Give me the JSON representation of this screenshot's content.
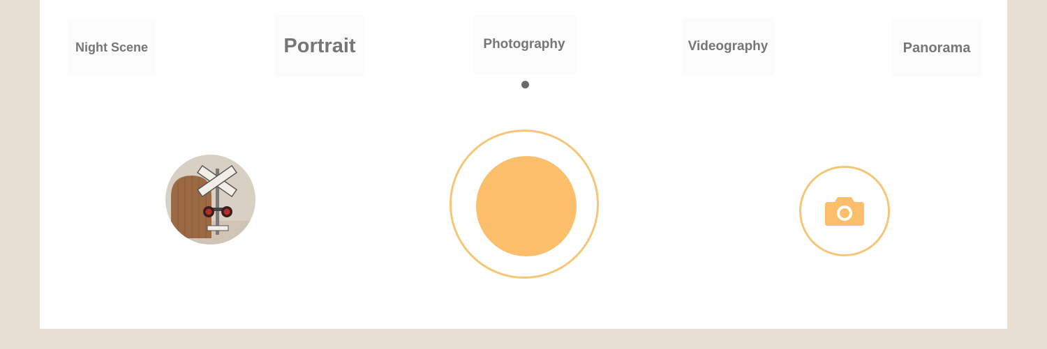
{
  "modes": {
    "night_scene": "Night Scene",
    "portrait": "Portrait",
    "photography": "Photography",
    "videography": "Videography",
    "panorama": "Panorama"
  },
  "selected_mode": "Photography",
  "controls": {
    "gallery_thumbnail_icon": "photo-thumbnail-icon",
    "shutter_icon": "shutter-button-icon",
    "switch_camera_icon": "camera-icon"
  },
  "colors": {
    "background": "#e8dfd4",
    "panel": "#ffffff",
    "accent": "#fbbf6b",
    "accent_ring": "#f5c676",
    "mode_text": "#767676",
    "indicator": "#6a6a6a"
  }
}
